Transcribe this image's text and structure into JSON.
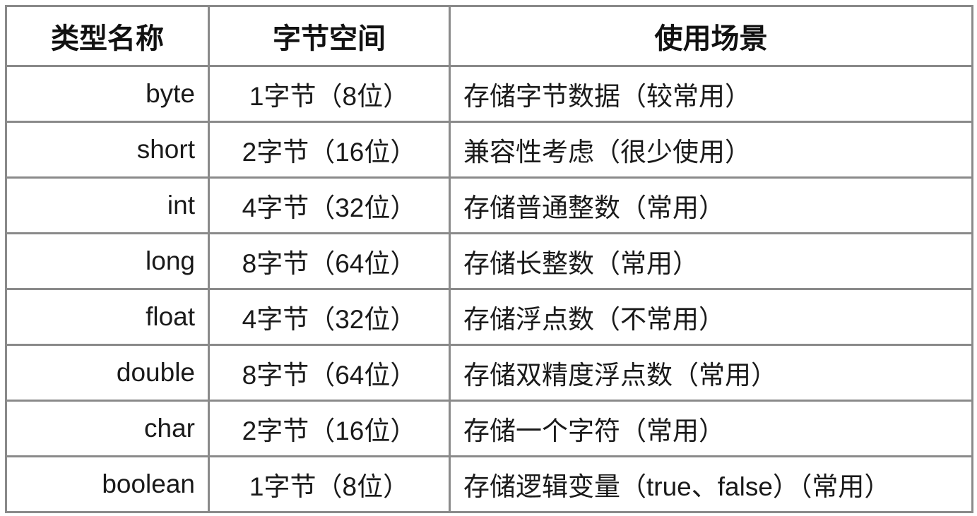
{
  "table": {
    "headers": [
      "类型名称",
      "字节空间",
      "使用场景"
    ],
    "rows": [
      [
        "byte",
        "1字节（8位）",
        "存储字节数据（较常用）"
      ],
      [
        "short",
        "2字节（16位）",
        "兼容性考虑（很少使用）"
      ],
      [
        "int",
        "4字节（32位）",
        "存储普通整数（常用）"
      ],
      [
        "long",
        "8字节（64位）",
        "存储长整数（常用）"
      ],
      [
        "float",
        "4字节（32位）",
        "存储浮点数（不常用）"
      ],
      [
        "double",
        "8字节（64位）",
        "存储双精度浮点数（常用）"
      ],
      [
        "char",
        "2字节（16位）",
        "存储一个字符（常用）"
      ],
      [
        "boolean",
        "1字节（8位）",
        "存储逻辑变量（true、false）（常用）"
      ]
    ]
  }
}
